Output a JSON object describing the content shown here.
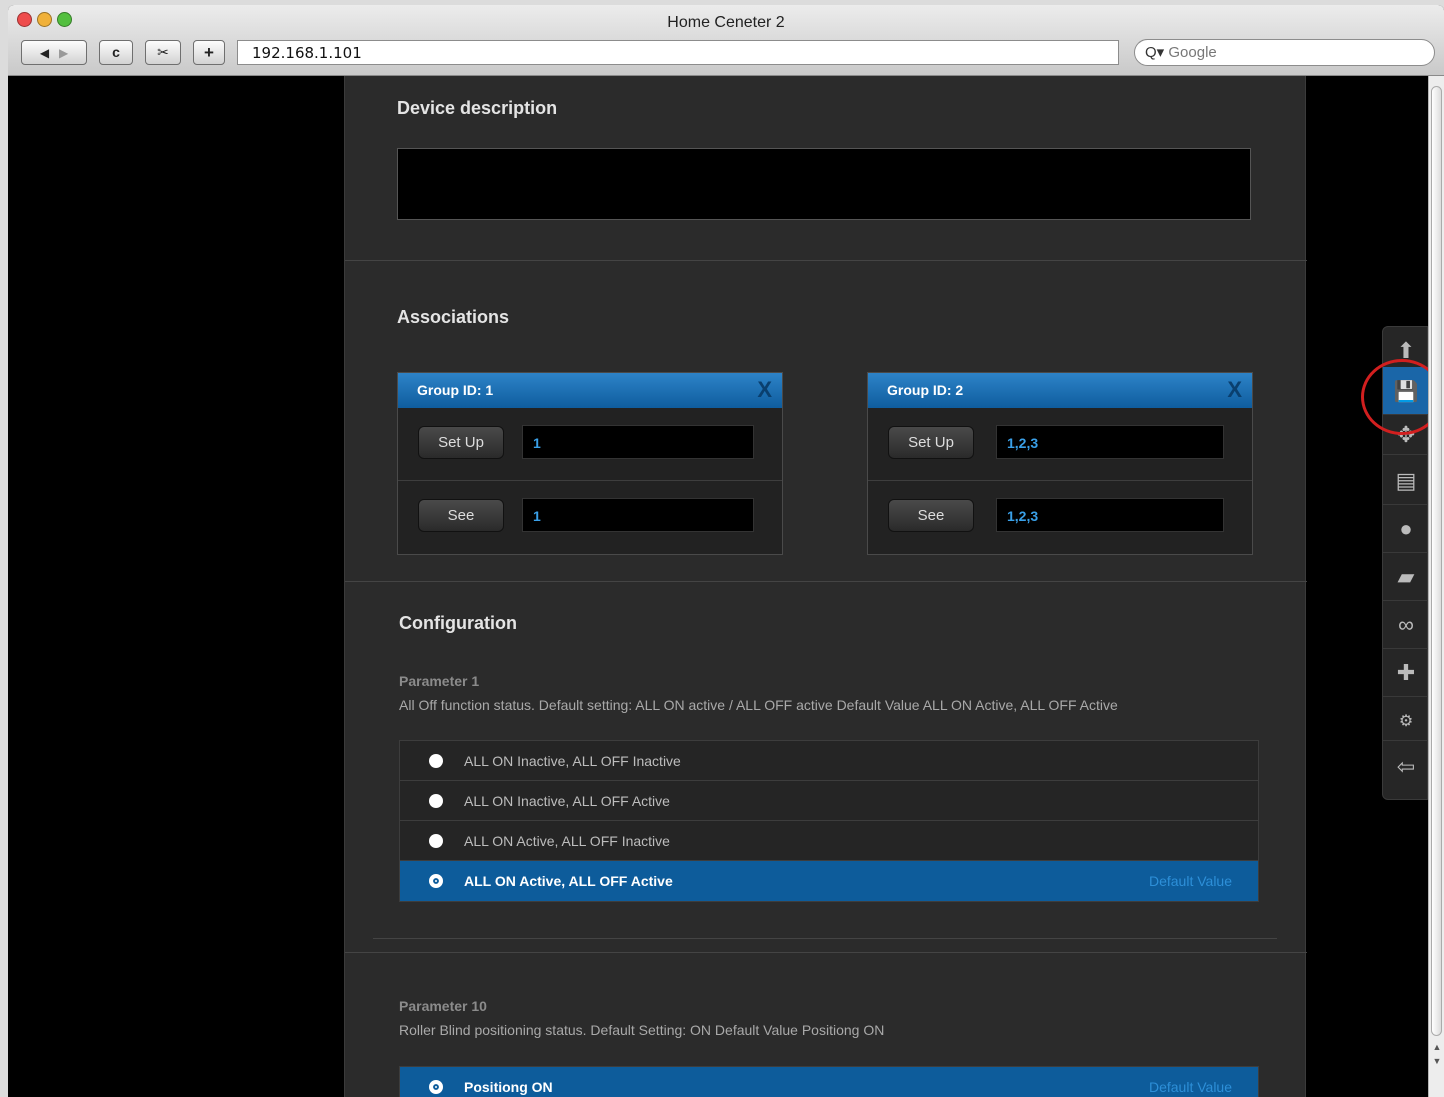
{
  "window": {
    "title": "Home Ceneter 2",
    "url": "192.168.1.101",
    "search_placeholder": "Google",
    "nav": {
      "back": "◀",
      "forward": "▶",
      "reload": "c",
      "snip": "✂",
      "add": "+"
    }
  },
  "description": {
    "title": "Device description",
    "value": ""
  },
  "associations": {
    "title": "Associations",
    "groups": [
      {
        "id_label": "Group ID: 1",
        "close": "X",
        "setup_label": "Set Up",
        "setup_value": "1",
        "see_label": "See",
        "see_value": "1"
      },
      {
        "id_label": "Group ID: 2",
        "close": "X",
        "setup_label": "Set Up",
        "setup_value": "1,2,3",
        "see_label": "See",
        "see_value": "1,2,3"
      }
    ]
  },
  "configuration": {
    "title": "Configuration",
    "parameters": [
      {
        "title": "Parameter 1",
        "description": "All Off function status. Default setting: ALL ON active / ALL OFF active Default Value ALL ON Active, ALL OFF Active",
        "options": [
          {
            "label": "ALL ON Inactive, ALL OFF Inactive",
            "selected": false
          },
          {
            "label": "ALL ON Inactive, ALL OFF Active",
            "selected": false
          },
          {
            "label": "ALL ON Active, ALL OFF Inactive",
            "selected": false
          },
          {
            "label": "ALL ON Active, ALL OFF Active",
            "selected": true,
            "default_label": "Default Value"
          }
        ]
      },
      {
        "title": "Parameter 10",
        "description": "Roller Blind positioning status. Default Setting: ON Default Value Positiong ON",
        "options": [
          {
            "label": "Positiong ON",
            "selected": true,
            "default_label": "Default Value"
          }
        ]
      }
    ]
  },
  "toolbar": {
    "items": [
      {
        "name": "up-arrow-icon",
        "glyph": "⬆"
      },
      {
        "name": "save-icon",
        "glyph": "💾",
        "active": true
      },
      {
        "name": "move-icon",
        "glyph": "✥"
      },
      {
        "name": "device-icon",
        "glyph": "▤"
      },
      {
        "name": "bulb-icon",
        "glyph": "●"
      },
      {
        "name": "scene-icon",
        "glyph": "▰"
      },
      {
        "name": "link-icon",
        "glyph": "∞"
      },
      {
        "name": "plugin-icon",
        "glyph": "✚"
      },
      {
        "name": "settings-icon",
        "glyph": "⚙"
      },
      {
        "name": "exit-icon",
        "glyph": "⇦"
      }
    ]
  },
  "colors": {
    "accent": "#0d5c9b",
    "highlight_circle": "#d21f1f",
    "value_text": "#3aa0e8"
  }
}
